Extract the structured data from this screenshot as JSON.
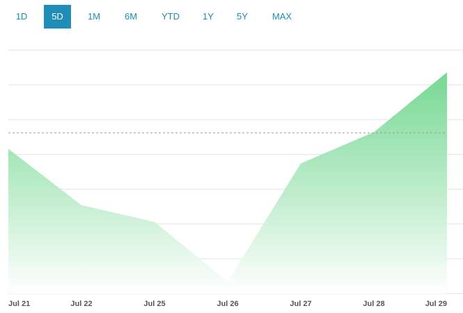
{
  "range_tabs": [
    {
      "label": "1D",
      "active": false
    },
    {
      "label": "5D",
      "active": true
    },
    {
      "label": "1M",
      "active": false
    },
    {
      "label": "6M",
      "active": false
    },
    {
      "label": "YTD",
      "active": false
    },
    {
      "label": "1Y",
      "active": false
    },
    {
      "label": "5Y",
      "active": false
    },
    {
      "label": "MAX",
      "active": false
    }
  ],
  "colors": {
    "accent": "#1f8db5",
    "tab_text": "#1a8fb0",
    "area_top": "#6fd68e",
    "area_bottom": "#ffffff",
    "grid": "#e2e2e2",
    "reference_line": "#999999"
  },
  "chart_data": {
    "type": "area",
    "categories": [
      "Jul 21",
      "Jul 22",
      "Jul 25",
      "Jul 26",
      "Jul 27",
      "Jul 28",
      "Jul 29"
    ],
    "series": [
      {
        "values": [
          41.6,
          25.4,
          20.6,
          3.4,
          37.4,
          46.4,
          63.6
        ]
      }
    ],
    "reference_line": 46.2,
    "ylim": [
      0,
      70
    ],
    "grid": true,
    "y_tick_labels_shown": false
  }
}
